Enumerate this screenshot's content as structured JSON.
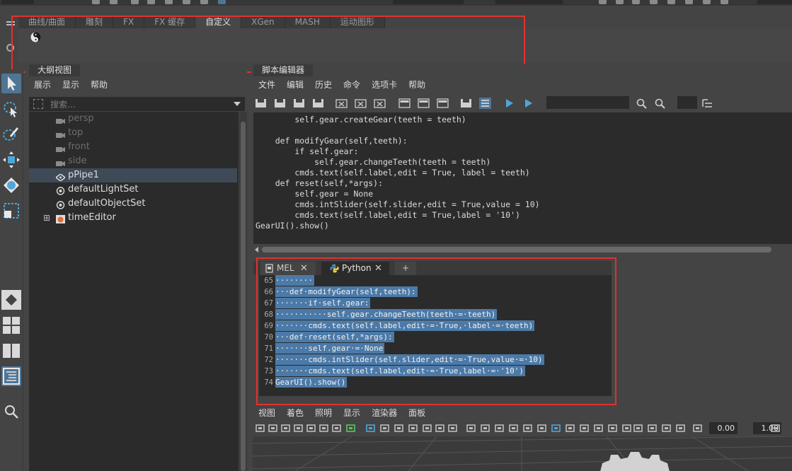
{
  "shelf": {
    "tabs": [
      "曲线/曲面",
      "雕刻",
      "FX",
      "FX 缓存",
      "自定义",
      "XGen",
      "MASH",
      "运动图形"
    ],
    "active_tab": "自定义"
  },
  "outliner": {
    "tab_title": "大纲视图",
    "menu": [
      "展示",
      "显示",
      "帮助"
    ],
    "search_placeholder": "搜索...",
    "items": [
      {
        "label": "persp",
        "icon": "camera-icon",
        "state": "dim"
      },
      {
        "label": "top",
        "icon": "camera-icon",
        "state": "dim"
      },
      {
        "label": "front",
        "icon": "camera-icon",
        "state": "dim"
      },
      {
        "label": "side",
        "icon": "camera-icon",
        "state": "dim"
      },
      {
        "label": "pPipe1",
        "icon": "mesh-icon",
        "state": "selected"
      },
      {
        "label": "defaultLightSet",
        "icon": "set-icon",
        "state": "normal"
      },
      {
        "label": "defaultObjectSet",
        "icon": "set-icon",
        "state": "normal"
      },
      {
        "label": "timeEditor",
        "icon": "time-editor-icon",
        "state": "normal",
        "expand": "⊞"
      }
    ]
  },
  "script_editor": {
    "tab_title": "脚本编辑器",
    "menu": [
      "文件",
      "编辑",
      "历史",
      "命令",
      "选项卡",
      "帮助"
    ],
    "history_lines": [
      "        self.gear.createGear(teeth = teeth)",
      "",
      "    def modifyGear(self,teeth):",
      "        if self.gear:",
      "            self.gear.changeTeeth(teeth = teeth)",
      "        cmds.text(self.label,edit = True, label = teeth)",
      "    def reset(self,*args):",
      "        self.gear = None",
      "        cmds.intSlider(self.slider,edit = True,value = 10)",
      "        cmds.text(self.label,edit = True,label = '10')",
      "GearUI().show()"
    ],
    "tabs": [
      {
        "label": "MEL",
        "close": "✕"
      },
      {
        "label": "Python",
        "close": "✕"
      },
      {
        "label": "+"
      }
    ],
    "active_tab": "Python",
    "input_lines": [
      {
        "n": "65",
        "code": "········"
      },
      {
        "n": "66",
        "code": "···def·modifyGear(self,teeth):"
      },
      {
        "n": "67",
        "code": "·······if·self.gear:"
      },
      {
        "n": "68",
        "code": "···········self.gear.changeTeeth(teeth·=·teeth)"
      },
      {
        "n": "69",
        "code": "·······cmds.text(self.label,edit·=·True,·label·=·teeth)"
      },
      {
        "n": "70",
        "code": "···def·reset(self,*args):"
      },
      {
        "n": "71",
        "code": "·······self.gear·=·None"
      },
      {
        "n": "72",
        "code": "·······cmds.intSlider(self.slider,edit·=·True,value·=·10)"
      },
      {
        "n": "73",
        "code": "·······cmds.text(self.label,edit·=·True,label·=·'10')"
      },
      {
        "n": "74",
        "code": "GearUI().show()"
      }
    ]
  },
  "viewport": {
    "menu": [
      "视图",
      "着色",
      "照明",
      "显示",
      "渲染器",
      "面板"
    ],
    "field1": "0.00",
    "field2": "1.00"
  },
  "colors": {
    "highlight_box": "#e1312f",
    "selection": "#4c7aa8"
  }
}
